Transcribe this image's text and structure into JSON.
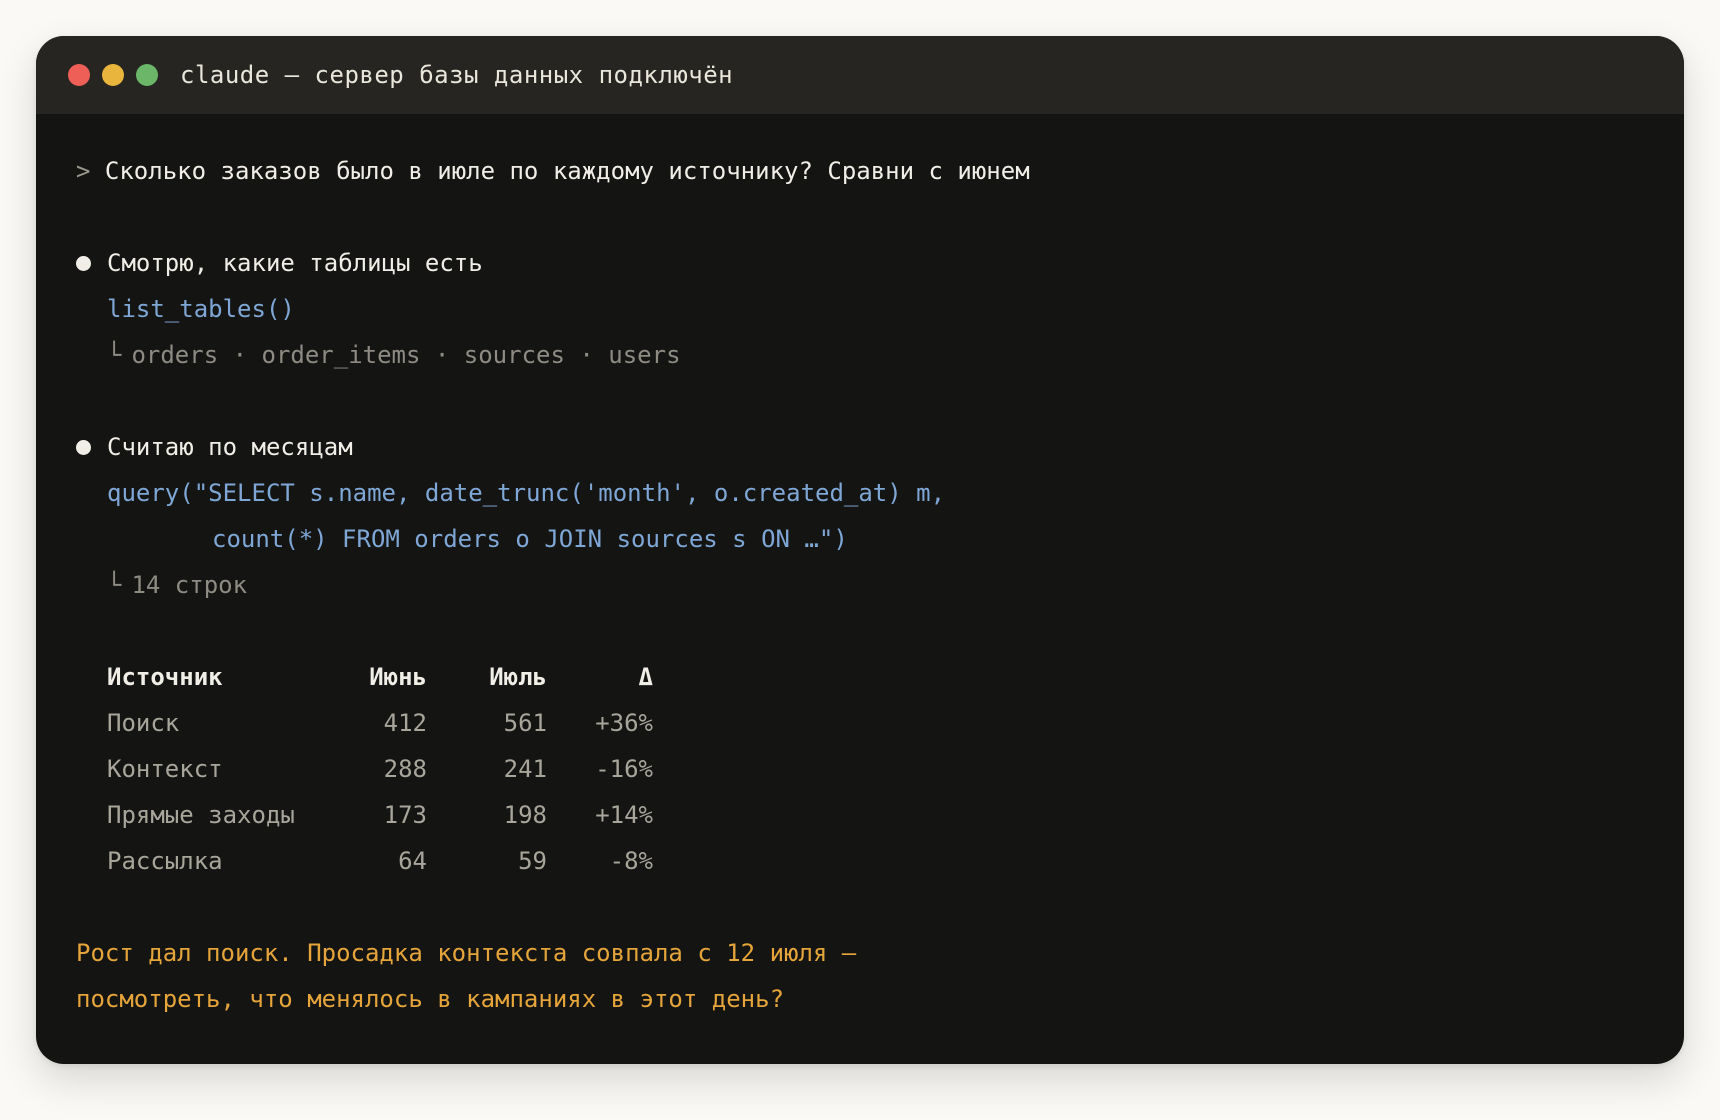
{
  "window": {
    "title": "claude — сервер базы данных подключён"
  },
  "prompt": {
    "symbol": ">",
    "text": "Сколько заказов было в июле по каждому источнику? Сравни с июнем"
  },
  "steps": [
    {
      "label": "Смотрю, какие таблицы есть",
      "call_lines": [
        "list_tables()"
      ],
      "result_prefix": "└",
      "result": "orders · order_items · sources · users"
    },
    {
      "label": "Считаю по месяцам",
      "call_lines": [
        "query(\"SELECT s.name, date_trunc('month', o.created_at) m,",
        "count(*) FROM orders o JOIN sources s ON …\")"
      ],
      "result_prefix": "└",
      "result": "14 строк"
    }
  ],
  "table": {
    "headers": [
      "Источник",
      "Июнь",
      "Июль",
      "Δ"
    ],
    "rows": [
      [
        "Поиск",
        "412",
        "561",
        "+36%"
      ],
      [
        "Контекст",
        "288",
        "241",
        "-16%"
      ],
      [
        "Прямые заходы",
        "173",
        "198",
        "+14%"
      ],
      [
        "Рассылка",
        "64",
        "59",
        "-8%"
      ]
    ]
  },
  "summary": [
    "Рост дал поиск. Просадка контекста совпала с 12 июля —",
    "посмотреть, что менялось в кампаниях в этот день?"
  ],
  "colors": {
    "background": "#faf9f5",
    "terminal": "#141413",
    "titlebar": "#262521",
    "code": "#7fa7d6",
    "summary": "#e5a53a",
    "dot_red": "#ed5f57",
    "dot_yellow": "#e9b53c",
    "dot_green": "#6cb66a"
  }
}
